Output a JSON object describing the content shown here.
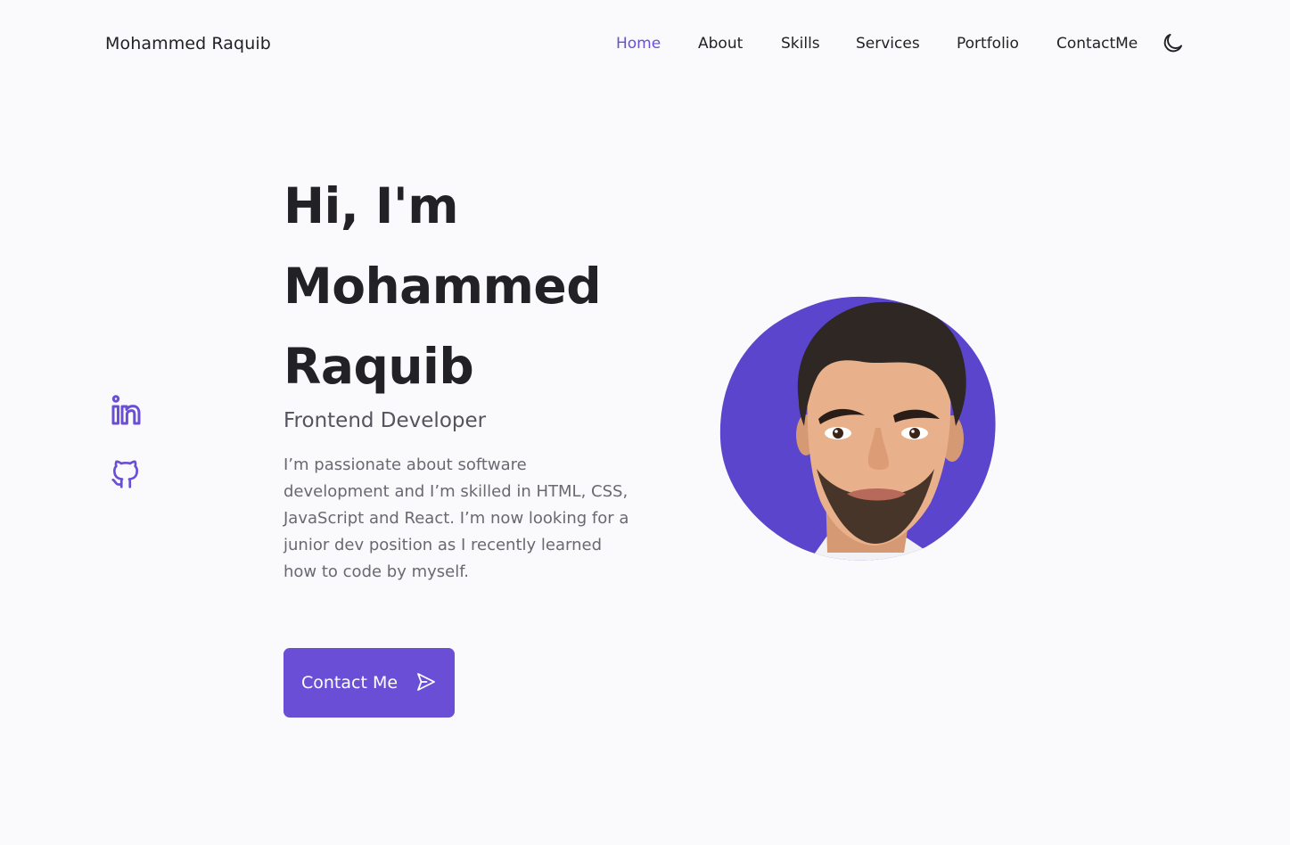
{
  "header": {
    "logo": "Mohammed Raquib",
    "nav": [
      {
        "label": "Home",
        "active": true
      },
      {
        "label": "About"
      },
      {
        "label": "Skills"
      },
      {
        "label": "Services"
      },
      {
        "label": "Portfolio"
      },
      {
        "label": "ContactMe"
      }
    ],
    "theme_toggle_icon": "moon-icon"
  },
  "social": [
    {
      "icon": "linkedin-icon"
    },
    {
      "icon": "github-icon"
    }
  ],
  "hero": {
    "title_lines": [
      "Hi, I'm",
      "Mohammed",
      "Raquib"
    ],
    "subtitle": "Frontend Developer",
    "description": "I’m passionate about software development and I’m skilled in HTML, CSS, JavaScript and React. I’m now looking for a junior dev position as I recently learned how to code by myself.",
    "cta_label": "Contact Me",
    "cta_icon": "send-icon",
    "avatar_icon": "profile-avatar-image"
  },
  "colors": {
    "accent": "#6a4fd6",
    "blob": "#5a45cc",
    "text": "#222226",
    "muted": "#6a6870",
    "background": "#fafafc"
  }
}
